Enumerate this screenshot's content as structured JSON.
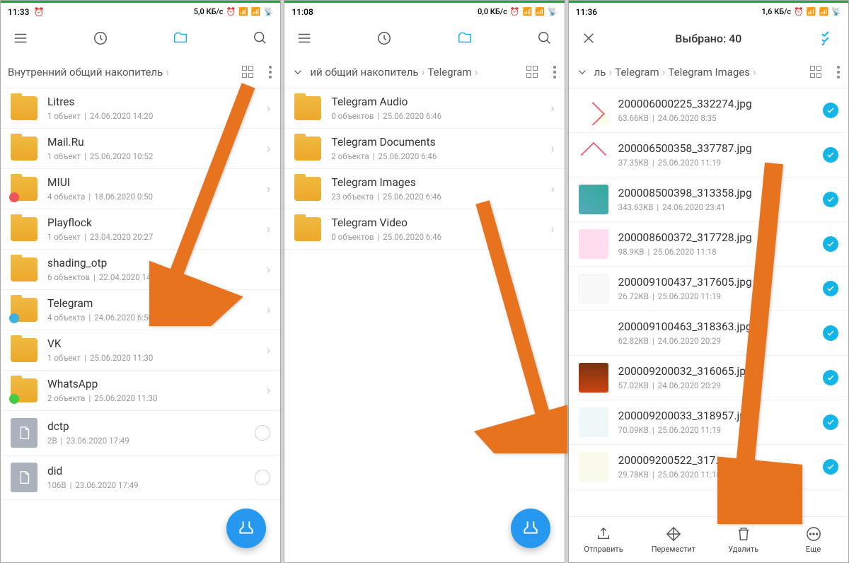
{
  "screen1": {
    "time": "11:33",
    "netspeed": "5,0 КБ/с",
    "breadcrumb": [
      "Внутренний общий накопитель"
    ],
    "items": [
      {
        "name": "Litres",
        "meta1": "1 объект",
        "meta2": "24.06.2020 14:20",
        "type": "folder"
      },
      {
        "name": "Mail.Ru",
        "meta1": "1 объект",
        "meta2": "25.06.2020 10:52",
        "type": "folder"
      },
      {
        "name": "MIUI",
        "meta1": "4 объекта",
        "meta2": "18.06.2020 0:50",
        "type": "folder",
        "badge": "b1"
      },
      {
        "name": "Playflock",
        "meta1": "1 объект",
        "meta2": "23.04.2020 20:27",
        "type": "folder"
      },
      {
        "name": "shading_otp",
        "meta1": "6 объектов",
        "meta2": "22.04.2020 14:09",
        "type": "folder"
      },
      {
        "name": "Telegram",
        "meta1": "4 объекта",
        "meta2": "24.06.2020 6:50",
        "type": "folder",
        "badge": "b2"
      },
      {
        "name": "VK",
        "meta1": "1 объект",
        "meta2": "25.06.2020 11:30",
        "type": "folder"
      },
      {
        "name": "WhatsApp",
        "meta1": "2 объекта",
        "meta2": "25.06.2020 11:30",
        "type": "folder",
        "badge": "b3"
      },
      {
        "name": "dctp",
        "meta1": "2B",
        "meta2": "23.06.2020 17:49",
        "type": "file"
      },
      {
        "name": "did",
        "meta1": "106B",
        "meta2": "23.06.2020 17:49",
        "type": "file"
      }
    ]
  },
  "screen2": {
    "time": "11:08",
    "netspeed": "0,0 КБ/с",
    "breadcrumb": [
      "ий общий накопитель",
      "Telegram"
    ],
    "items": [
      {
        "name": "Telegram Audio",
        "meta1": "0 объектов",
        "meta2": "25.06.2020 6:46",
        "type": "folder"
      },
      {
        "name": "Telegram Documents",
        "meta1": "2 объекта",
        "meta2": "25.06.2020 6:46",
        "type": "folder"
      },
      {
        "name": "Telegram Images",
        "meta1": "23 объекта",
        "meta2": "25.06.2020 6:46",
        "type": "folder"
      },
      {
        "name": "Telegram Video",
        "meta1": "0 объектов",
        "meta2": "25.06.2020 6:46",
        "type": "folder"
      }
    ]
  },
  "screen3": {
    "time": "11:36",
    "netspeed": "1,6 КБ/с",
    "title": "Выбрано: 40",
    "breadcrumb": [
      "ль",
      "Telegram",
      "Telegram Images"
    ],
    "items": [
      {
        "name": "200006000225_332274.jpg",
        "meta1": "63.66KB",
        "meta2": "24.06.2020 8:35",
        "thumb": "t1"
      },
      {
        "name": "200006500358_337787.jpg",
        "meta1": "37.35KB",
        "meta2": "25.06.2020 11:19",
        "thumb": "t2"
      },
      {
        "name": "200008500398_313358.jpg",
        "meta1": "343.63KB",
        "meta2": "24.06.2020 23:41",
        "thumb": "t3"
      },
      {
        "name": "200008600372_317728.jpg",
        "meta1": "98.9KB",
        "meta2": "25.06.2020 11:18",
        "thumb": "t4"
      },
      {
        "name": "200009100437_317605.jpg",
        "meta1": "26.72KB",
        "meta2": "25.06.2020 11:19",
        "thumb": "t5"
      },
      {
        "name": "200009100463_318363.jpg",
        "meta1": "62.82KB",
        "meta2": "24.06.2020 20:29",
        "thumb": "t6"
      },
      {
        "name": "200009200032_316065.jpg",
        "meta1": "57.02KB",
        "meta2": "24.06.2020 20:29",
        "thumb": "t7"
      },
      {
        "name": "200009200033_318957.jpg",
        "meta1": "70.09KB",
        "meta2": "25.06.2020 11:19",
        "thumb": "t8"
      },
      {
        "name": "200009200522_317...",
        "meta1": "29.78KB",
        "meta2": "25.06.2020 11:18",
        "thumb": "t9"
      }
    ],
    "actions": {
      "send": "Отправить",
      "move": "Переместит",
      "delete": "Удалить",
      "more": "Еще"
    }
  }
}
